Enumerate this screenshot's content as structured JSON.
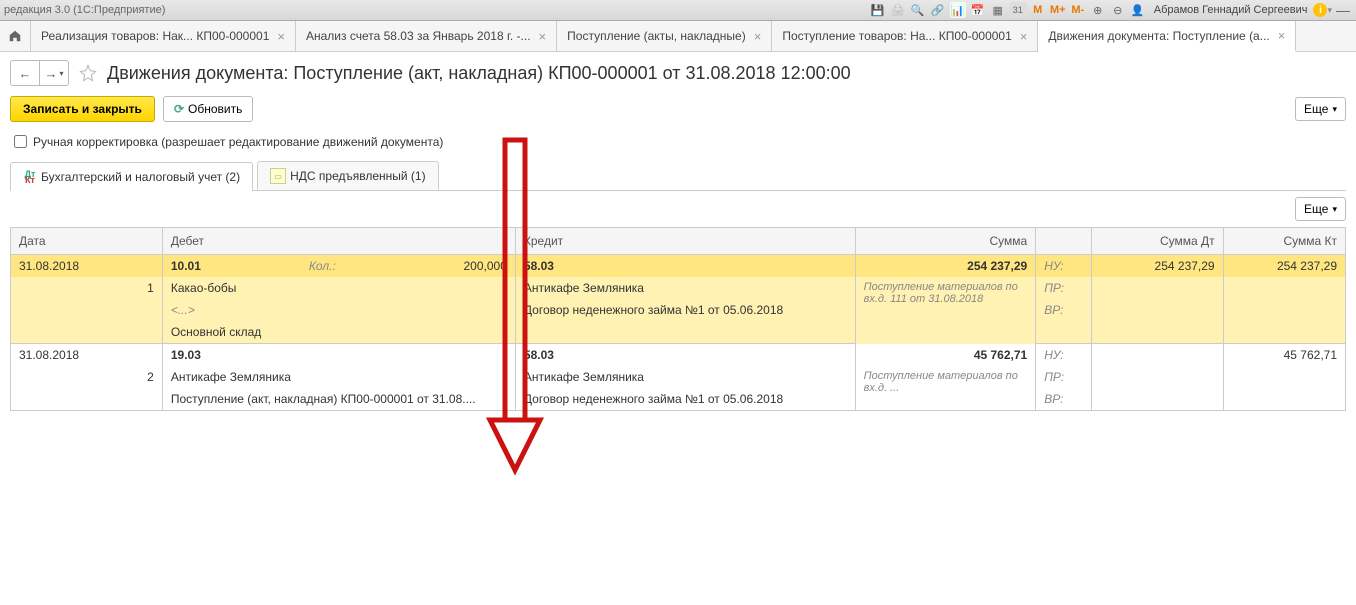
{
  "window": {
    "title": "редакция 3.0  (1С:Предприятие)",
    "user": "Абрамов Геннадий Сергеевич"
  },
  "tabs": [
    {
      "label": "Реализация товаров: Нак... КП00-000001"
    },
    {
      "label": "Анализ счета 58.03 за Январь 2018 г. -..."
    },
    {
      "label": "Поступление (акты, накладные)"
    },
    {
      "label": "Поступление товаров: На... КП00-000001"
    },
    {
      "label": "Движения документа: Поступление (а..."
    }
  ],
  "page": {
    "title": "Движения документа: Поступление (акт, накладная) КП00-000001 от 31.08.2018 12:00:00"
  },
  "toolbar": {
    "save_close": "Записать и закрыть",
    "refresh": "Обновить",
    "more": "Еще"
  },
  "checkbox": {
    "label": "Ручная корректировка (разрешает редактирование движений документа)"
  },
  "subtabs": [
    {
      "label": "Бухгалтерский и налоговый учет (2)"
    },
    {
      "label": "НДС предъявленный (1)"
    }
  ],
  "table": {
    "headers": {
      "date": "Дата",
      "debit": "Дебет",
      "credit": "Кредит",
      "sum": "Сумма",
      "sumdt": "Сумма Дт",
      "sumkt": "Сумма Кт"
    },
    "rows": [
      {
        "date": "31.08.2018",
        "num": "1",
        "debit_acc": "10.01",
        "kol_label": "Кол.:",
        "kol": "200,000",
        "debit_sub1": "Какао-бобы",
        "debit_sub2": "<...>",
        "debit_sub3": "Основной склад",
        "credit_acc": "58.03",
        "credit_sub1": "Антикафе Земляника",
        "credit_sub2": "Договор неденежного займа №1 от 05.06.2018",
        "sum": "254 237,29",
        "sum_desc": "Поступление материалов по вх.д. 111 от 31.08.2018",
        "nu": "НУ:",
        "pr": "ПР:",
        "vr": "ВР:",
        "sumdt": "254 237,29",
        "sumkt": "254 237,29"
      },
      {
        "date": "31.08.2018",
        "num": "2",
        "debit_acc": "19.03",
        "debit_sub1": "Антикафе Земляника",
        "debit_sub2": "Поступление (акт, накладная) КП00-000001 от 31.08....",
        "credit_acc": "58.03",
        "credit_sub1": "Антикафе Земляника",
        "credit_sub2": "Договор неденежного займа №1 от 05.06.2018",
        "sum": "45 762,71",
        "sum_desc": "Поступление материалов по вх.д. ...",
        "nu": "НУ:",
        "pr": "ПР:",
        "vr": "ВР:",
        "sumkt": "45 762,71"
      }
    ]
  }
}
